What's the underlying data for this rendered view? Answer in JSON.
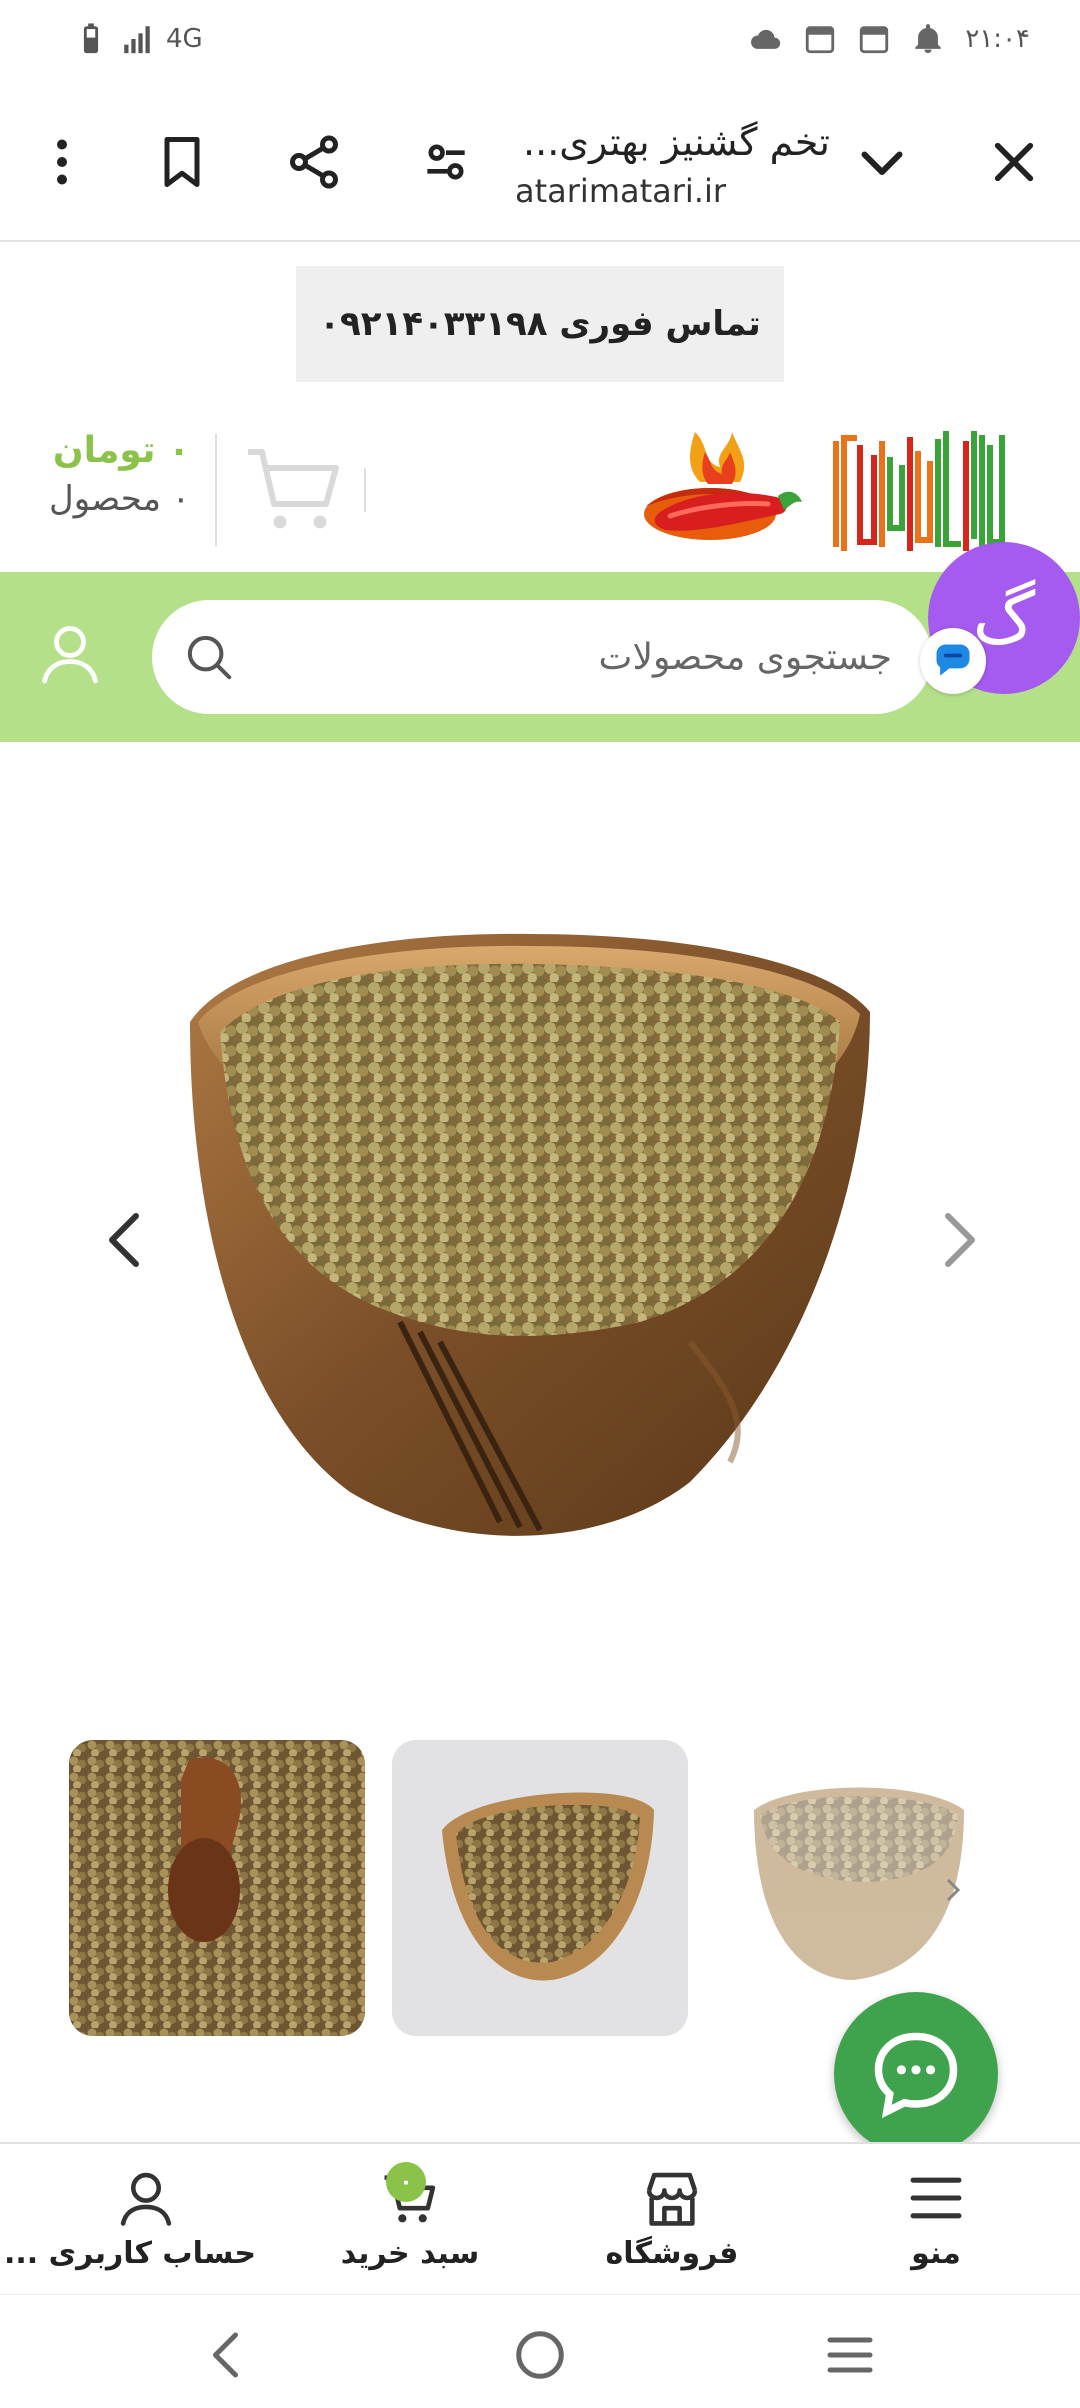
{
  "status_bar": {
    "network": "4G",
    "time": "۲۱:۰۴"
  },
  "browser": {
    "title": "تخم گشنیز بهتری...",
    "url": "atarimatari.ir",
    "icons": [
      "close-icon",
      "chevron-down-icon",
      "site-settings-icon",
      "share-icon",
      "bookmark-icon",
      "more-vert-icon"
    ]
  },
  "contact": {
    "label": "تماس فوری ۰۹۲۱۴۰۳۳۱۹۸"
  },
  "header": {
    "cart_total": "۰ تومان",
    "cart_count": "۰ محصول"
  },
  "search": {
    "placeholder": "جستجوی محصولات"
  },
  "chat_widget": {
    "letter": "گ"
  },
  "colors": {
    "accent_green": "#8bc34a",
    "search_strip": "#b5e08a",
    "chat_fab": "#3fa34d",
    "goftino_purple": "#a55af0"
  },
  "bottom_nav": {
    "items": [
      {
        "label": "منو",
        "icon": "menu-icon"
      },
      {
        "label": "فروشگاه",
        "icon": "store-icon"
      },
      {
        "label": "سبد خرید",
        "icon": "cart-icon",
        "badge": "۰"
      },
      {
        "label": "حساب کاربری ...",
        "icon": "user-icon"
      }
    ]
  }
}
